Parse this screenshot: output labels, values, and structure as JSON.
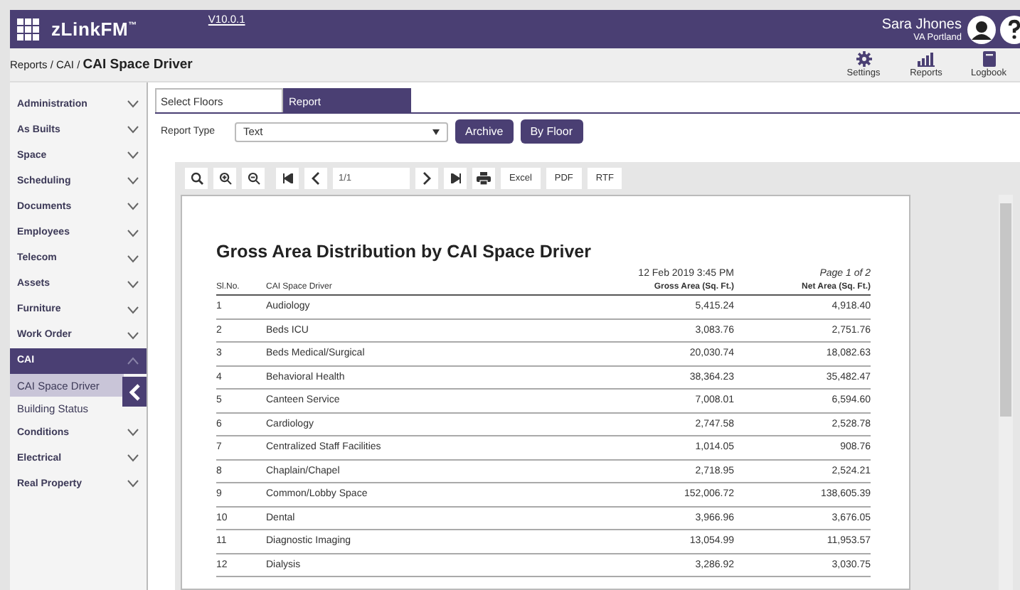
{
  "header": {
    "app_title": "zLinkFM$^{™}$",
    "version": "V10.0.1",
    "user_name": "Sara Jhones",
    "user_location": "VA Portland"
  },
  "breadcrumb": {
    "path": "Reports / CAI /",
    "current": "CAI Space Driver"
  },
  "actions": [
    {
      "label": "Settings",
      "kind": "gear"
    },
    {
      "label": "Reports",
      "kind": "chart"
    },
    {
      "label": "Logbook",
      "kind": "book"
    }
  ],
  "sidebar": {
    "items": [
      {
        "label": "Administration",
        "expanded": false
      },
      {
        "label": "As Builts",
        "expanded": false
      },
      {
        "label": "Space",
        "expanded": false
      },
      {
        "label": "Scheduling",
        "expanded": false
      },
      {
        "label": "Documents",
        "expanded": false
      },
      {
        "label": "Employees",
        "expanded": false
      },
      {
        "label": "Telecom",
        "expanded": false
      },
      {
        "label": "Assets",
        "expanded": false
      },
      {
        "label": "Furniture",
        "expanded": false
      },
      {
        "label": "Work Order",
        "expanded": false
      },
      {
        "label": "CAI",
        "expanded": true,
        "children": [
          {
            "label": "CAI Space Driver",
            "selected": true
          },
          {
            "label": "Building Status",
            "selected": false
          }
        ]
      },
      {
        "label": "Conditions",
        "expanded": false
      },
      {
        "label": "Electrical",
        "expanded": false
      },
      {
        "label": "Real Property",
        "expanded": false
      }
    ]
  },
  "tabs": [
    {
      "label": "Select Floors",
      "selected": false
    },
    {
      "label": "Report",
      "selected": true
    }
  ],
  "report_type": {
    "label": "Report Type",
    "value": "Text"
  },
  "buttons": [
    "Archive",
    "By Floor"
  ],
  "viewer_toolbar": {
    "page_field": "1/1",
    "export_buttons": [
      "Excel",
      "PDF",
      "RTF"
    ]
  },
  "report": {
    "title": "Gross Area Distribution by CAI Space Driver",
    "timestamp": "12 Feb 2019 3:45 PM",
    "page": "Page 1 of 2",
    "columns": [
      "Sl.No.",
      "CAI Space Driver",
      "Gross Area (Sq. Ft.)",
      "Net Area (Sq. Ft.)"
    ],
    "rows": [
      [
        "1",
        "Audiology",
        "5,415.24",
        "4,918.40"
      ],
      [
        "2",
        "Beds ICU",
        "3,083.76",
        "2,751.76"
      ],
      [
        "3",
        "Beds Medical/Surgical",
        "20,030.74",
        "18,082.63"
      ],
      [
        "4",
        "Behavioral Health",
        "38,364.23",
        "35,482.47"
      ],
      [
        "5",
        "Canteen Service",
        "7,008.01",
        "6,594.60"
      ],
      [
        "6",
        "Cardiology",
        "2,747.58",
        "2,528.78"
      ],
      [
        "7",
        "Centralized Staff Facilities",
        "1,014.05",
        "908.76"
      ],
      [
        "8",
        "Chaplain/Chapel",
        "2,718.95",
        "2,524.21"
      ],
      [
        "9",
        "Common/Lobby Space",
        "152,006.72",
        "138,605.39"
      ],
      [
        "10",
        "Dental",
        "3,966.96",
        "3,676.05"
      ],
      [
        "11",
        "Diagnostic Imaging",
        "13,054.99",
        "11,953.57"
      ],
      [
        "12",
        "Dialysis",
        "3,286.92",
        "3,030.75"
      ]
    ]
  }
}
